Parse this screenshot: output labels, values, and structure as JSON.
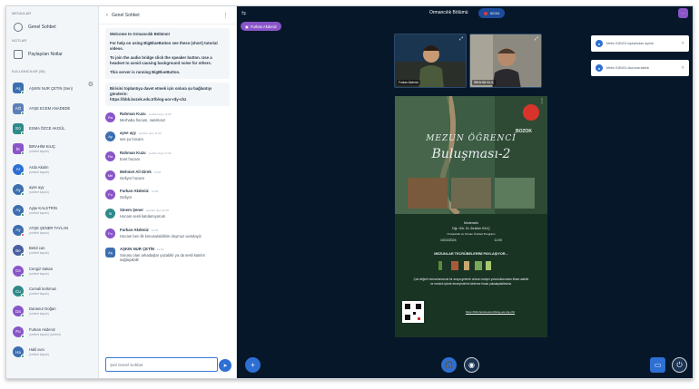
{
  "sidebar": {
    "messages_title": "MESAJLAR",
    "public_chat": "Genel Sohbet",
    "notes_title": "NOTLAR",
    "shared_notes": "Paylaşılan Notlar",
    "users_title": "KULLANICILAR (36)",
    "users": [
      {
        "initials": "Aş",
        "name": "AŞKIN NUR ÇETİN (Sen)",
        "sub": ""
      },
      {
        "initials": "AÖ",
        "name": "AYŞE ECEM ANADEDE",
        "sub": ""
      },
      {
        "initials": "Eö",
        "name": "ESMA ÖZCE AKGÜL",
        "sub": ""
      },
      {
        "initials": "İK",
        "name": "İBRAHİM KILIÇ",
        "sub": "(sohbet kapalı)"
      },
      {
        "initials": "Ar",
        "name": "Arda Akalın",
        "sub": "(sohbet kapalı)"
      },
      {
        "initials": "Ay",
        "name": "ayse ayy",
        "sub": "(sohbet kapalı)"
      },
      {
        "initials": "Ay",
        "name": "Ayşe KALSTRİN",
        "sub": "(sohbet kapalı)"
      },
      {
        "initials": "Ay",
        "name": "AYŞE ŞENER TAYLAN",
        "sub": "(sohbet kapalı)"
      },
      {
        "initials": "Be",
        "name": "Betül can",
        "sub": "(sohbet kapalı)"
      },
      {
        "initials": "Ce",
        "name": "Cengiz Sakan",
        "sub": "(sohbet kapalı)"
      },
      {
        "initials": "Cu",
        "name": "Cumali korkmaz",
        "sub": "(sohbet kapalı)"
      },
      {
        "initials": "Da",
        "name": "Dananur Doğan",
        "sub": "(sohbet kapalı)"
      },
      {
        "initials": "Fu",
        "name": "Furkan Akdeniz",
        "sub": "(sohbet kapalı) (sohbet)"
      },
      {
        "initials": "Ha",
        "name": "Halil avcı",
        "sub": "(sohbet kapalı)"
      }
    ]
  },
  "chat": {
    "title": "Genel Sohbet",
    "welcome": [
      "Welcome to Ormancılık Bölümü!",
      "For help on using BigBlueButton see these (short) tutorial videos.",
      "To join the audio bridge click the speaker button. Use a headset to avoid causing background noise for others.",
      "This server is running BigBlueButton."
    ],
    "invite_text": "Birisini toplantıya davet etmek için onlara şu bağlantıyı gönderin:",
    "invite_link": "https://bbb.bozok.edu.tr/b/og-uor-rdy-chz",
    "messages": [
      {
        "initials": "Ra",
        "name": "Rahman Kuzu",
        "meta": "(sohbet dışı) 11:00",
        "text": "Merhaba hocam, nasılsınız"
      },
      {
        "initials": "Ay",
        "name": "ayse ayy",
        "meta": "(sohbet dışı) 11:00",
        "text": "ses şu hocam"
      },
      {
        "initials": "Ra",
        "name": "Rahman Kuzu",
        "meta": "(sohbet dışı) 11:00",
        "text": "Evet hocam"
      },
      {
        "initials": "Me",
        "name": "Mehmet Ali Direk",
        "meta": "11:00",
        "text": "Geliyor hocam"
      },
      {
        "initials": "Fu",
        "name": "Furkan Akdeniz",
        "meta": "11:00",
        "text": "Geliyor"
      },
      {
        "initials": "Si",
        "name": "Sinem Şener",
        "meta": "(sohbet dışı) 11:00",
        "text": "Hocam sesli katılamıyorum"
      },
      {
        "initials": "Fu",
        "name": "Furkan Akdeniz",
        "meta": "11:00",
        "text": "Hocam ben ilk konusulabilirim duymuz avindayiz"
      },
      {
        "initials": "Aş",
        "name": "AŞKIN NUR ÇETİN",
        "meta": "11:01",
        "text": "Sorusu olan arkadaşlar yazabilir ya da sesli katılım sağlayabilir"
      }
    ],
    "input_placeholder": "Şeti Genel Sohbet"
  },
  "meeting": {
    "room_title": "Ormancılık Bölümü",
    "record_label": "00:54",
    "presenter_badge": "Furkan Akdeniz",
    "tiles": [
      {
        "label": "Furkan Akdeniz"
      },
      {
        "label": "İBRAHİM KILIÇ"
      }
    ],
    "notifications": [
      "Metin GÜNOL toplantıdan ayrıldı",
      "Metin GÜNOL oturuma katıldı"
    ],
    "slide": {
      "title_line1": "MEZUN ÖĞRENCİ",
      "title_line2": "Buluşması-2",
      "logo_text": "BOZOK",
      "moderator_label": "Moderatör",
      "moderator_name": "Dğr. Gör. Dr. İbrahim KILIÇ",
      "moderator_dept": "Ormancılık ve Orman Ürünleri Programı",
      "date": "10/10/2024",
      "time": "11:00",
      "share_text": "MEZUNLAR TECRÜBELERİNİ PAYLAŞIYOR...",
      "body": "Çok değerli mezunlarımızla bir araya gelerek onların kariyer yolculuklarından ilham alabilir ve meslek içinde deneyimlerini dinleme fırsatı yakalayabilirsiniz.",
      "link": "https://bbb.bozok.edu.tr/b/og-uor-rdy-chz"
    }
  },
  "colors": {
    "meeting_bg": "#06172a",
    "accent_blue": "#2d6fd3",
    "presenter_purple": "#8a55c9",
    "slide_green": "#1e3a29"
  }
}
